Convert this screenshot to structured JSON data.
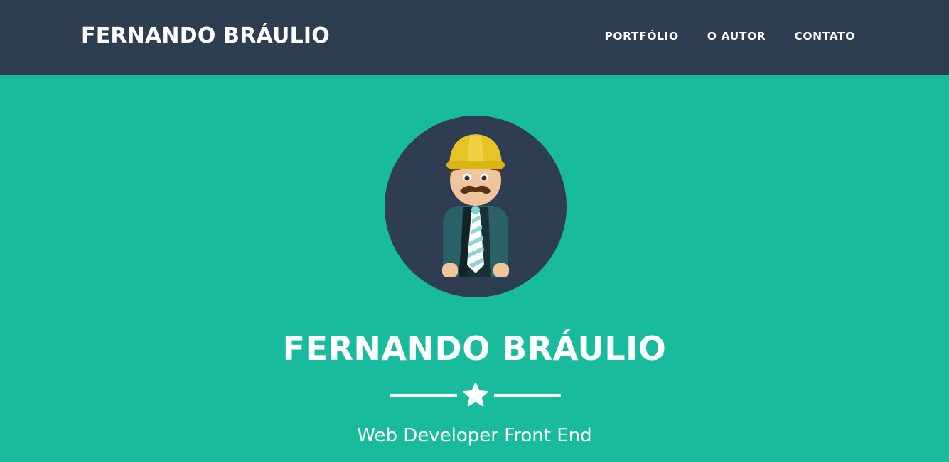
{
  "navbar": {
    "brand": "FERNANDO BRÁULIO",
    "links": [
      {
        "label": "PORTFÓLIO"
      },
      {
        "label": "O AUTOR"
      },
      {
        "label": "CONTATO"
      }
    ]
  },
  "hero": {
    "avatar_icon": "developer-avatar-icon",
    "title": "FERNANDO BRÁULIO",
    "divider_icon": "star-icon",
    "subtitle": "Web Developer Front End"
  },
  "colors": {
    "navbar_bg": "#2c3e50",
    "hero_bg": "#18bc9c",
    "text": "#ffffff",
    "helmet": "#e7c425",
    "skin": "#f0c49c",
    "jacket": "#2a6068"
  }
}
